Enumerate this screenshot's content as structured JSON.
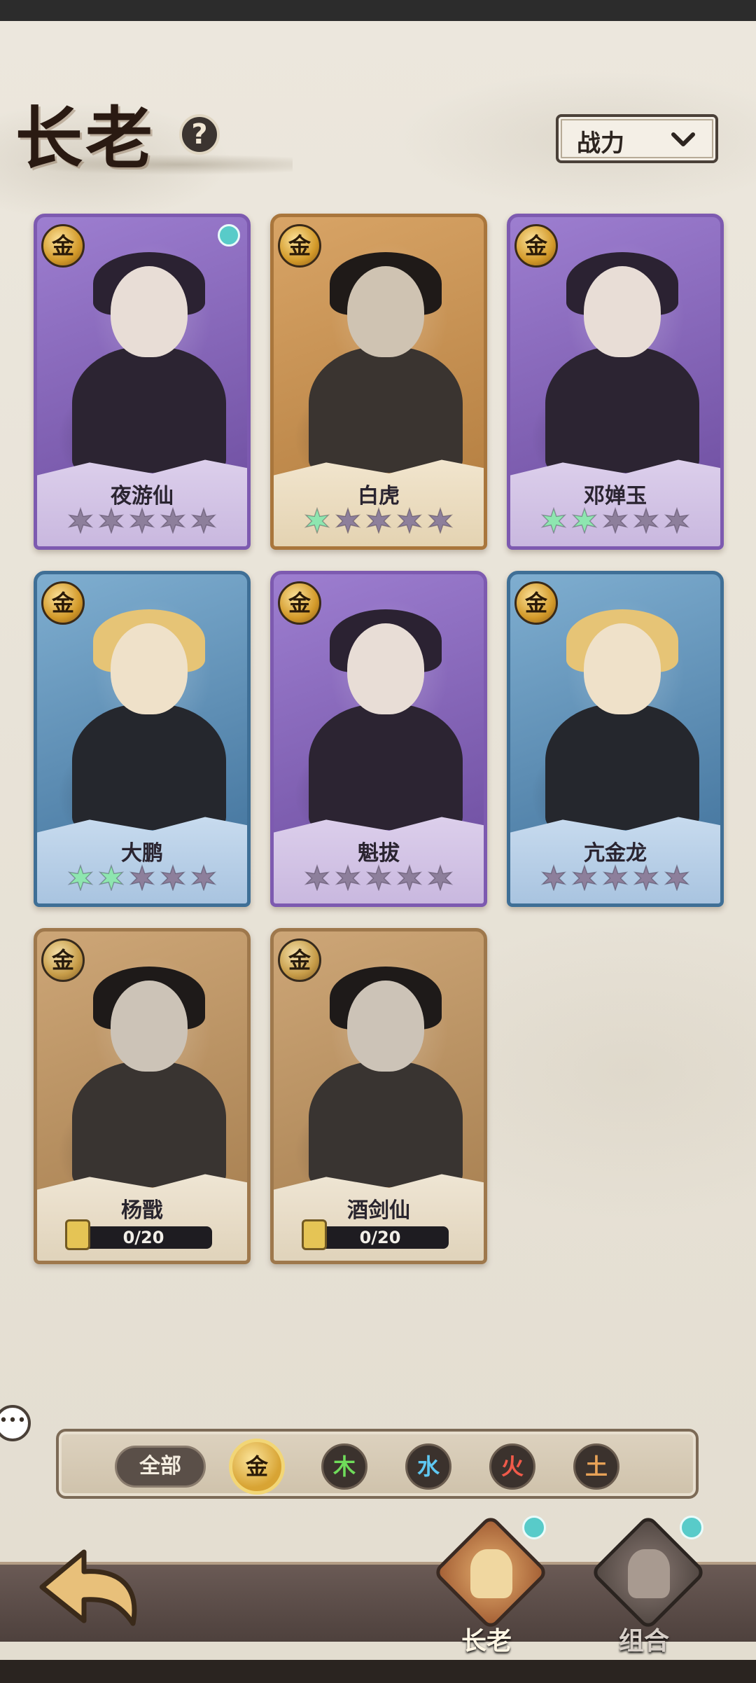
{
  "header": {
    "title": "长老",
    "help_icon": "question-mark-icon",
    "sort": {
      "selected": "战力",
      "icon": "chevron-down-icon"
    }
  },
  "heroes": [
    {
      "name": "夜游仙",
      "element": "金",
      "frame": "purple",
      "stars_total": 5,
      "stars_filled": 0,
      "upgrade_available": true
    },
    {
      "name": "白虎",
      "element": "金",
      "frame": "orange",
      "stars_total": 5,
      "stars_filled": 1,
      "upgrade_available": false
    },
    {
      "name": "邓婵玉",
      "element": "金",
      "frame": "purple",
      "stars_total": 5,
      "stars_filled": 2,
      "upgrade_available": false
    },
    {
      "name": "大鹏",
      "element": "金",
      "frame": "blue",
      "stars_total": 5,
      "stars_filled": 2,
      "upgrade_available": false
    },
    {
      "name": "魁拔",
      "element": "金",
      "frame": "purple",
      "stars_total": 5,
      "stars_filled": 0,
      "upgrade_available": false
    },
    {
      "name": "亢金龙",
      "element": "金",
      "frame": "blue",
      "stars_total": 5,
      "stars_filled": 0,
      "upgrade_available": false
    },
    {
      "name": "杨戬",
      "element": "金",
      "frame": "orange",
      "locked": true,
      "shards": "0/20"
    },
    {
      "name": "酒剑仙",
      "element": "金",
      "frame": "orange",
      "locked": true,
      "shards": "0/20"
    }
  ],
  "filters": {
    "all_label": "全部",
    "elements": [
      {
        "label": "金",
        "color": "#2a1a08",
        "active": true
      },
      {
        "label": "木",
        "color": "#6fdc5a",
        "active": false
      },
      {
        "label": "水",
        "color": "#5ec8f2",
        "active": false
      },
      {
        "label": "火",
        "color": "#f05a4a",
        "active": false
      },
      {
        "label": "土",
        "color": "#e8a257",
        "active": false
      }
    ]
  },
  "nav": {
    "tabs": [
      {
        "label": "长老",
        "active": true,
        "badge": "upgrade-arrow-icon"
      },
      {
        "label": "组合",
        "active": false,
        "badge": "upgrade-arrow-icon"
      }
    ]
  },
  "colors": {
    "star_filled": "#8ee6b0",
    "star_empty": "#8d7f9b",
    "upgrade_badge": "#58cbc9"
  }
}
